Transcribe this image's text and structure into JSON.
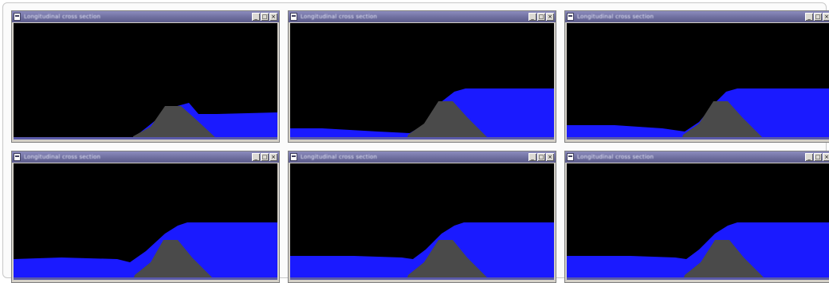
{
  "window_title": "Longitudinal cross section",
  "title_buttons": [
    {
      "name": "minimize",
      "glyph": "_"
    },
    {
      "name": "maximize",
      "glyph": "□"
    },
    {
      "name": "close",
      "glyph": "×"
    }
  ],
  "colors": {
    "background": "#000000",
    "water": "#1a1aff",
    "terrain": "#4a4a4a",
    "titlebar": "#6c6c9c"
  },
  "icons": [
    "window-app-icon",
    "minimize-icon",
    "maximize-icon",
    "close-icon"
  ],
  "panels": [
    {
      "id": "frame-1",
      "upstream_level": 0.0,
      "downstream_level": 0.27,
      "crest": 0.38
    },
    {
      "id": "frame-2",
      "upstream_level": 0.14,
      "downstream_level": 0.55,
      "crest": 0.38
    },
    {
      "id": "frame-3",
      "upstream_level": 0.16,
      "downstream_level": 0.55,
      "crest": 0.38
    },
    {
      "id": "frame-4",
      "upstream_level": 0.22,
      "downstream_level": 0.48,
      "crest": 0.38
    },
    {
      "id": "frame-5",
      "upstream_level": 0.24,
      "downstream_level": 0.48,
      "crest": 0.38
    },
    {
      "id": "frame-6",
      "upstream_level": 0.24,
      "downstream_level": 0.48,
      "crest": 0.38
    }
  ]
}
